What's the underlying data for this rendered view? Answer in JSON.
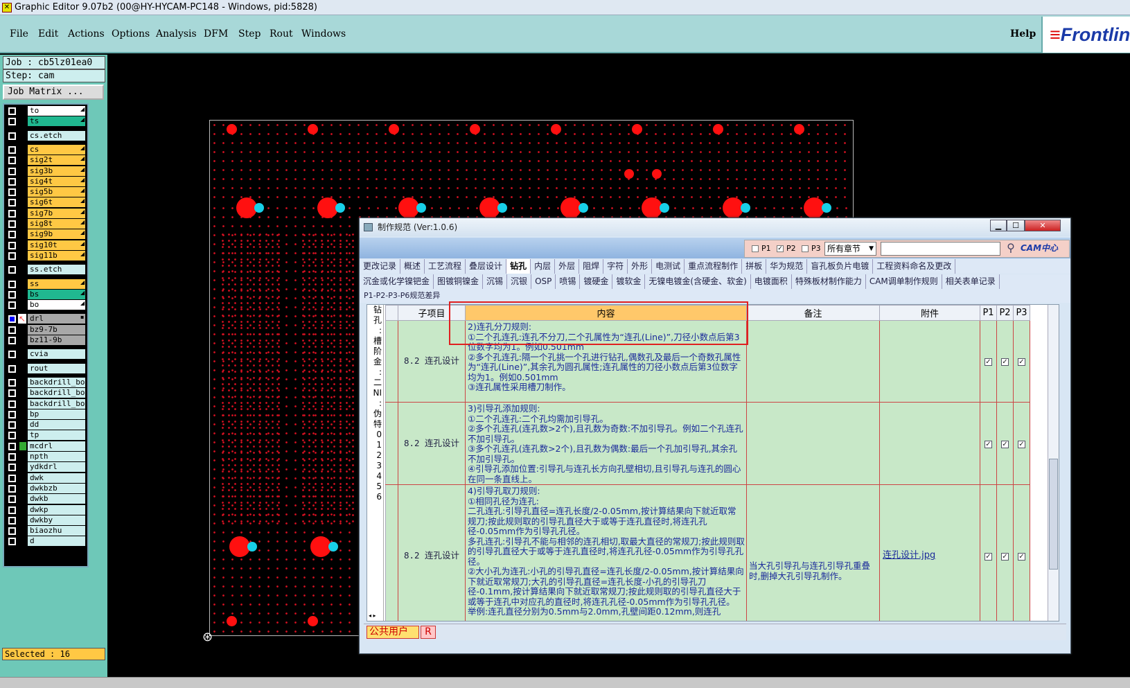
{
  "window": {
    "title": "Graphic Editor 9.07b2 (00@HY-HYCAM-PC148 - Windows, pid:5828)"
  },
  "menu": {
    "items": [
      "File",
      "Edit",
      "Actions",
      "Options",
      "Analysis",
      "DFM",
      "Step",
      "Rout",
      "Windows"
    ],
    "help": "Help",
    "logo": "Frontline"
  },
  "left_panel": {
    "job": "Job : cb5lz01ea0",
    "step": "Step: cam",
    "job_matrix": "Job Matrix ...",
    "layers": [
      {
        "name": "to",
        "color": "#ffffff",
        "arrow": "◢"
      },
      {
        "name": "ts",
        "color": "#20b890",
        "arrow": "◢"
      },
      {
        "name": "cs.etch",
        "color": "#cdeeee",
        "arrow": ""
      },
      {
        "name": "cs",
        "color": "#ffc844",
        "arrow": "◢"
      },
      {
        "name": "sig2t",
        "color": "#ffc844",
        "arrow": "◢"
      },
      {
        "name": "sig3b",
        "color": "#ffc844",
        "arrow": "◢"
      },
      {
        "name": "sig4t",
        "color": "#ffc844",
        "arrow": "◢"
      },
      {
        "name": "sig5b",
        "color": "#ffc844",
        "arrow": "◢"
      },
      {
        "name": "sig6t",
        "color": "#ffc844",
        "arrow": "◢"
      },
      {
        "name": "sig7b",
        "color": "#ffc844",
        "arrow": "◢"
      },
      {
        "name": "sig8t",
        "color": "#ffc844",
        "arrow": "◢"
      },
      {
        "name": "sig9b",
        "color": "#ffc844",
        "arrow": "◢"
      },
      {
        "name": "sig10t",
        "color": "#ffc844",
        "arrow": "◢"
      },
      {
        "name": "sig11b",
        "color": "#ffc844",
        "arrow": "◢"
      },
      {
        "name": "ss.etch",
        "color": "#cdeeee",
        "arrow": ""
      },
      {
        "name": "ss",
        "color": "#ffc844",
        "arrow": "◢"
      },
      {
        "name": "bs",
        "color": "#20b890",
        "arrow": "◢"
      },
      {
        "name": "bo",
        "color": "#ffffff",
        "arrow": "◢"
      },
      {
        "name": "drl",
        "color": "#a8a8a8",
        "arrow": "▪"
      },
      {
        "name": "bz9-7b",
        "color": "#a8a8a8",
        "arrow": ""
      },
      {
        "name": "bz11-9b",
        "color": "#a8a8a8",
        "arrow": ""
      },
      {
        "name": "cvia",
        "color": "#cdeeee",
        "arrow": ""
      },
      {
        "name": "rout",
        "color": "#cdeeee",
        "arrow": ""
      },
      {
        "name": "backdrill_bo",
        "color": "#cdeeee",
        "arrow": ""
      },
      {
        "name": "backdrill_bo",
        "color": "#cdeeee",
        "arrow": ""
      },
      {
        "name": "backdrill_bo",
        "color": "#cdeeee",
        "arrow": ""
      },
      {
        "name": "bp",
        "color": "#cdeeee",
        "arrow": ""
      },
      {
        "name": "dd",
        "color": "#cdeeee",
        "arrow": ""
      },
      {
        "name": "tp",
        "color": "#cdeeee",
        "arrow": ""
      },
      {
        "name": "mcdrl",
        "color": "#cdeeee",
        "arrow": ""
      },
      {
        "name": "npth",
        "color": "#cdeeee",
        "arrow": ""
      },
      {
        "name": "ydkdrl",
        "color": "#cdeeee",
        "arrow": ""
      },
      {
        "name": "dwk",
        "color": "#cdeeee",
        "arrow": ""
      },
      {
        "name": "dwkbzb",
        "color": "#cdeeee",
        "arrow": ""
      },
      {
        "name": "dwkb",
        "color": "#cdeeee",
        "arrow": ""
      },
      {
        "name": "dwkp",
        "color": "#cdeeee",
        "arrow": ""
      },
      {
        "name": "dwkby",
        "color": "#cdeeee",
        "arrow": ""
      },
      {
        "name": "biaozhu",
        "color": "#cdeeee",
        "arrow": ""
      },
      {
        "name": "d",
        "color": "#cdeeee",
        "arrow": ""
      }
    ],
    "selected": "Selected : 16"
  },
  "dialog": {
    "title": "制作规范 (Ver:1.0.6)",
    "filter": {
      "p1": "P1",
      "p2": "P2",
      "p3": "P3",
      "chapter": "所有章节",
      "search_value": "",
      "cam_logo": "CAM中心"
    },
    "tabs_row1": [
      "更改记录",
      "概述",
      "工艺流程",
      "叠层设计",
      "钻孔",
      "内层",
      "外层",
      "阻焊",
      "字符",
      "外形",
      "电测试",
      "重点流程制作",
      "拼板",
      "华为规范",
      "盲孔板负片电镀",
      "工程资料命名及更改"
    ],
    "active_tab": "钻孔",
    "tabs_row2": [
      "沉金或化学镍钯金",
      "图镀铜镍金",
      "沉锡",
      "沉银",
      "OSP",
      "喷锡",
      "镀硬金",
      "镀软金",
      "无镍电镀金(含硬金、软金)",
      "电镀面积",
      "特殊板材制作能力",
      "CAM调单制作规则",
      "相关表单记录"
    ],
    "tabs_row3": "P1-P2-P3-P6规范差异",
    "left_strip": "钻\n孔\n:\n槽\n阶\n金\n:\n二\nNI\n:\n伪\n特\n0\n1\n2\n3\n4\n5\n6",
    "columns": {
      "sub": "子项目",
      "content": "内容",
      "note": "备注",
      "attach": "附件",
      "p1": "P1",
      "p2": "P2",
      "p3": "P3"
    },
    "rows": [
      {
        "sub": "8.2 连孔设计",
        "content": "2)连孔分刀规则:\n①二个孔连孔:连孔不分刀,二个孔属性为“连孔(Line)”,刀径小数点后第3位数字均为1。例如0.501mm\n②多个孔连孔:隔一个孔挑一个孔进行钻孔,偶数孔及最后一个奇数孔属性为“连孔(Line)”,其余孔为圆孔属性;连孔属性的刀径小数点后第3位数字均为1。例如0.501mm\n③连孔属性采用槽刀制作。",
        "note": "",
        "attach": "",
        "p1": "✓",
        "p2": "✓",
        "p3": "✓"
      },
      {
        "sub": "8.2 连孔设计",
        "content": "3)引导孔添加规则:\n①二个孔连孔:二个孔均需加引导孔。\n②多个孔连孔(连孔数>2个),且孔数为奇数:不加引导孔。例如二个孔连孔不加引导孔。\n③多个孔连孔(连孔数>2个),且孔数为偶数:最后一个孔加引导孔,其余孔不加引导孔。\n④引导孔添加位置:引导孔与连孔长方向孔壁相切,且引导孔与连孔的圆心在同一条直线上。",
        "note": "",
        "attach": "",
        "p1": "✓",
        "p2": "✓",
        "p3": "✓"
      },
      {
        "sub": "8.2 连孔设计",
        "content": "4)引导孔取刀规则:\n①相同孔径为连孔:\n二孔连孔:引导孔直径=连孔长度/2-0.05mm,按计算结果向下就近取常规刀;按此规则取的引导孔直径大于或等于连孔直径时,将连孔孔径-0.05mm作为引导孔孔径。\n多孔连孔:引导孔不能与相邻的连孔相切,取最大直径的常规刀;按此规则取的引导孔直径大于或等于连孔直径时,将连孔孔径-0.05mm作为引导孔孔径。\n②大小孔为连孔:小孔的引导孔直径=连孔长度/2-0.05mm,按计算结果向下就近取常规刀;大孔的引导孔直径=连孔长度-小孔的引导孔刀径-0.1mm,按计算结果向下就近取常规刀;按此规则取的引导孔直径大于或等于连孔中对应孔的直径时,将连孔孔径-0.05mm作为引导孔孔径。\n举例:连孔直径分别为0.5mm与2.0mm,孔壁间距0.12mm,则连孔",
        "note": "当大孔引导孔与连孔引导孔重叠时,删掉大孔引导孔制作。",
        "attach": "连孔设计.jpg",
        "p1": "✓",
        "p2": "✓",
        "p3": "✓"
      }
    ],
    "status": {
      "user": "公共用户",
      "role": "R"
    }
  }
}
